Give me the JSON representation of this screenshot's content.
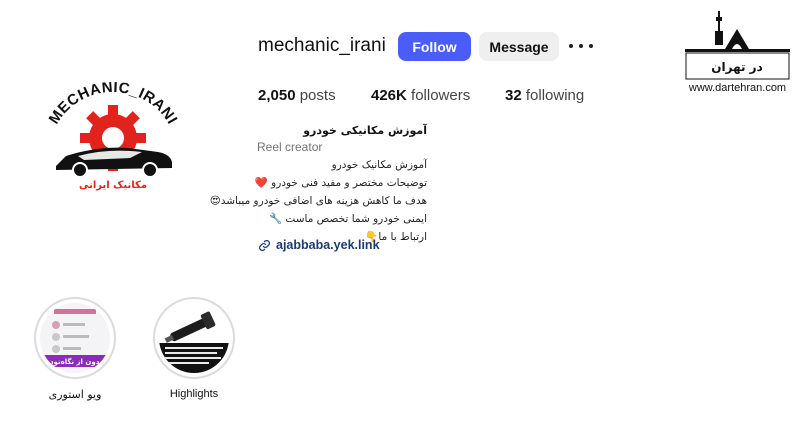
{
  "profile": {
    "username": "mechanic_irani",
    "follow_label": "Follow",
    "message_label": "Message",
    "more_icon": "more-horizontal-icon",
    "accent_color": "#4a5df9"
  },
  "stats": {
    "posts_count": "2,050",
    "posts_label": "posts",
    "followers_count": "426K",
    "followers_label": "followers",
    "following_count": "32",
    "following_label": "following"
  },
  "bio": {
    "name": "آموزش مکانیکی خودرو",
    "category": "Reel creator",
    "lines": [
      "آموزش مکانیک خودرو",
      "توضیحات مختصر و مفید فنی خودرو ❤️",
      "هدف ما کاهش هزینه های اضافی خودرو میباشد😍",
      "ایمنی خودرو شما تخصص ماست 🔧",
      "ارتباط با ما👇"
    ],
    "link": "ajabbaba.yek.link",
    "link_icon": "link-icon"
  },
  "avatar": {
    "logo_text": "MECHANIC_IRANI",
    "logo_subtext": "مکانیک ایرانی"
  },
  "highlights": [
    {
      "label": "ویو استوری",
      "badge": "بدون از نگاه‌نون"
    },
    {
      "label": "Highlights"
    }
  ],
  "watermark": {
    "title": "در تهران",
    "url": "www.dartehran.com"
  }
}
